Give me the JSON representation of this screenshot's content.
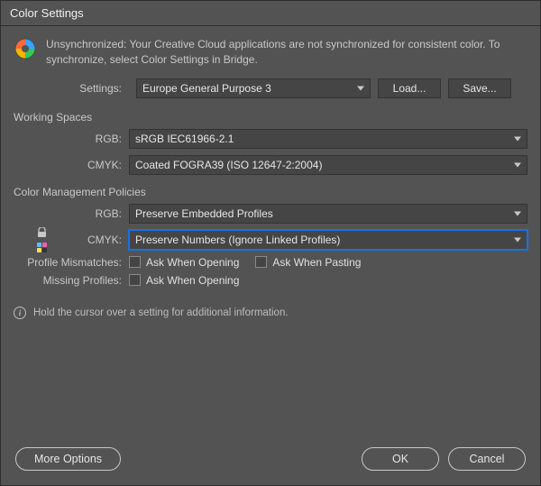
{
  "window": {
    "title": "Color Settings"
  },
  "sync": {
    "text": "Unsynchronized: Your Creative Cloud applications are not synchronized for consistent color. To synchronize, select Color Settings in Bridge."
  },
  "settings": {
    "label": "Settings:",
    "value": "Europe General Purpose 3",
    "load": "Load...",
    "save": "Save..."
  },
  "working_spaces": {
    "header": "Working Spaces",
    "rgb_label": "RGB:",
    "rgb_value": "sRGB IEC61966-2.1",
    "cmyk_label": "CMYK:",
    "cmyk_value": "Coated FOGRA39 (ISO 12647-2:2004)"
  },
  "policies": {
    "header": "Color Management Policies",
    "rgb_label": "RGB:",
    "rgb_value": "Preserve Embedded Profiles",
    "cmyk_label": "CMYK:",
    "cmyk_value": "Preserve Numbers (Ignore Linked Profiles)",
    "profile_mismatches_label": "Profile Mismatches:",
    "ask_open": "Ask When Opening",
    "ask_paste": "Ask When Pasting",
    "missing_profiles_label": "Missing Profiles:",
    "ask_open2": "Ask When Opening"
  },
  "info": {
    "text": "Hold the cursor over a setting for additional information."
  },
  "footer": {
    "more_options": "More Options",
    "ok": "OK",
    "cancel": "Cancel"
  }
}
